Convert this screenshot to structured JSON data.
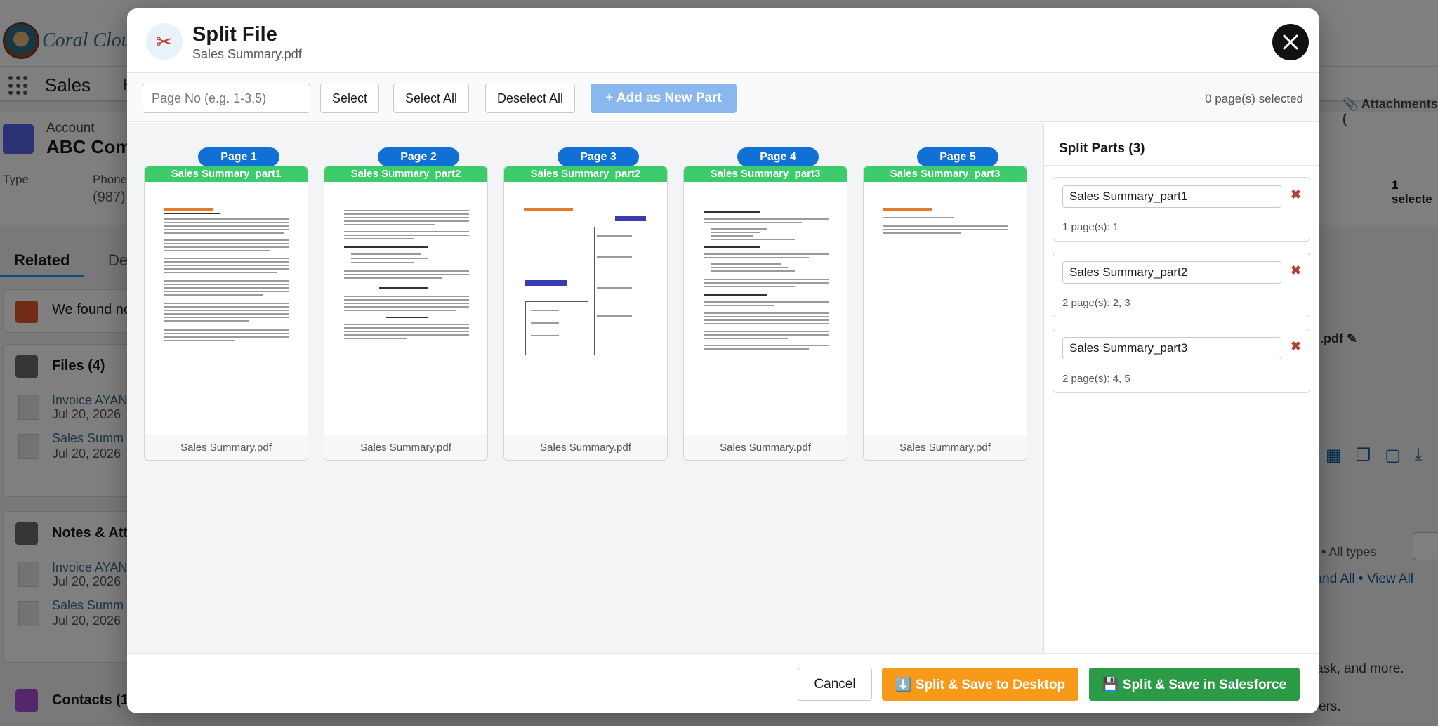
{
  "background": {
    "brand": "Coral Cloud",
    "app_name": "Sales",
    "nav_partial": "H",
    "account_label": "Account",
    "account_name": "ABC Com",
    "type_label": "Type",
    "phone_label": "Phone",
    "phone_value": "(987)",
    "related_tab": "Related",
    "details_tab": "De",
    "alert_text": "We found no",
    "files_title": "Files (4)",
    "files": [
      {
        "name": "Invoice AYAN",
        "date": "Jul 20, 2026"
      },
      {
        "name": "Sales Summ",
        "date": "Jul 20, 2026"
      }
    ],
    "notes_title": "Notes & Att",
    "notes": [
      {
        "name": "Invoice AYAN",
        "date": "Jul 20, 2026"
      },
      {
        "name": "Sales Summ",
        "date": "Jul 20, 2026"
      }
    ],
    "contacts_title": "Contacts (1",
    "attachments": "Attachments (",
    "selected_badge": "1 selecte",
    "pdf_label": ".pdf",
    "types_filter": "es • All types",
    "expand_links": "pand All  •  View All",
    "task_text": "ask, and more.",
    "ers_text": "ers."
  },
  "modal": {
    "title": "Split File",
    "subtitle": "Sales Summary.pdf",
    "toolbar": {
      "page_input_placeholder": "Page No (e.g. 1-3,5)",
      "select": "Select",
      "select_all": "Select All",
      "deselect_all": "Deselect All",
      "add_part": "+ Add as New Part",
      "selected_count": "0 page(s) selected"
    },
    "pages": [
      {
        "label": "Page 1",
        "part": "Sales Summary_part1",
        "file": "Sales Summary.pdf"
      },
      {
        "label": "Page 2",
        "part": "Sales Summary_part2",
        "file": "Sales Summary.pdf"
      },
      {
        "label": "Page 3",
        "part": "Sales Summary_part2",
        "file": "Sales Summary.pdf"
      },
      {
        "label": "Page 4",
        "part": "Sales Summary_part3",
        "file": "Sales Summary.pdf"
      },
      {
        "label": "Page 5",
        "part": "Sales Summary_part3",
        "file": "Sales Summary.pdf"
      }
    ],
    "split_parts": {
      "title": "Split Parts (3)",
      "parts": [
        {
          "name": "Sales Summary_part1",
          "info": "1 page(s): 1"
        },
        {
          "name": "Sales Summary_part2",
          "info": "2 page(s): 2, 3"
        },
        {
          "name": "Sales Summary_part3",
          "info": "2 page(s): 4, 5"
        }
      ]
    },
    "footer": {
      "cancel": "Cancel",
      "save_desktop": "⬇️ Split & Save to Desktop",
      "save_salesforce": "💾 Split & Save in Salesforce"
    }
  },
  "colors": {
    "page_pill": "#1170d6",
    "part_strip": "#3ccc6b",
    "add_button_disabled": "#8ab8ee",
    "desktop_button": "#f79a1a",
    "salesforce_button": "#2b9b45",
    "delete_icon": "#c23934"
  },
  "icons": {
    "modal": "scissors-icon",
    "close": "close-icon",
    "delete": "delete-icon"
  }
}
